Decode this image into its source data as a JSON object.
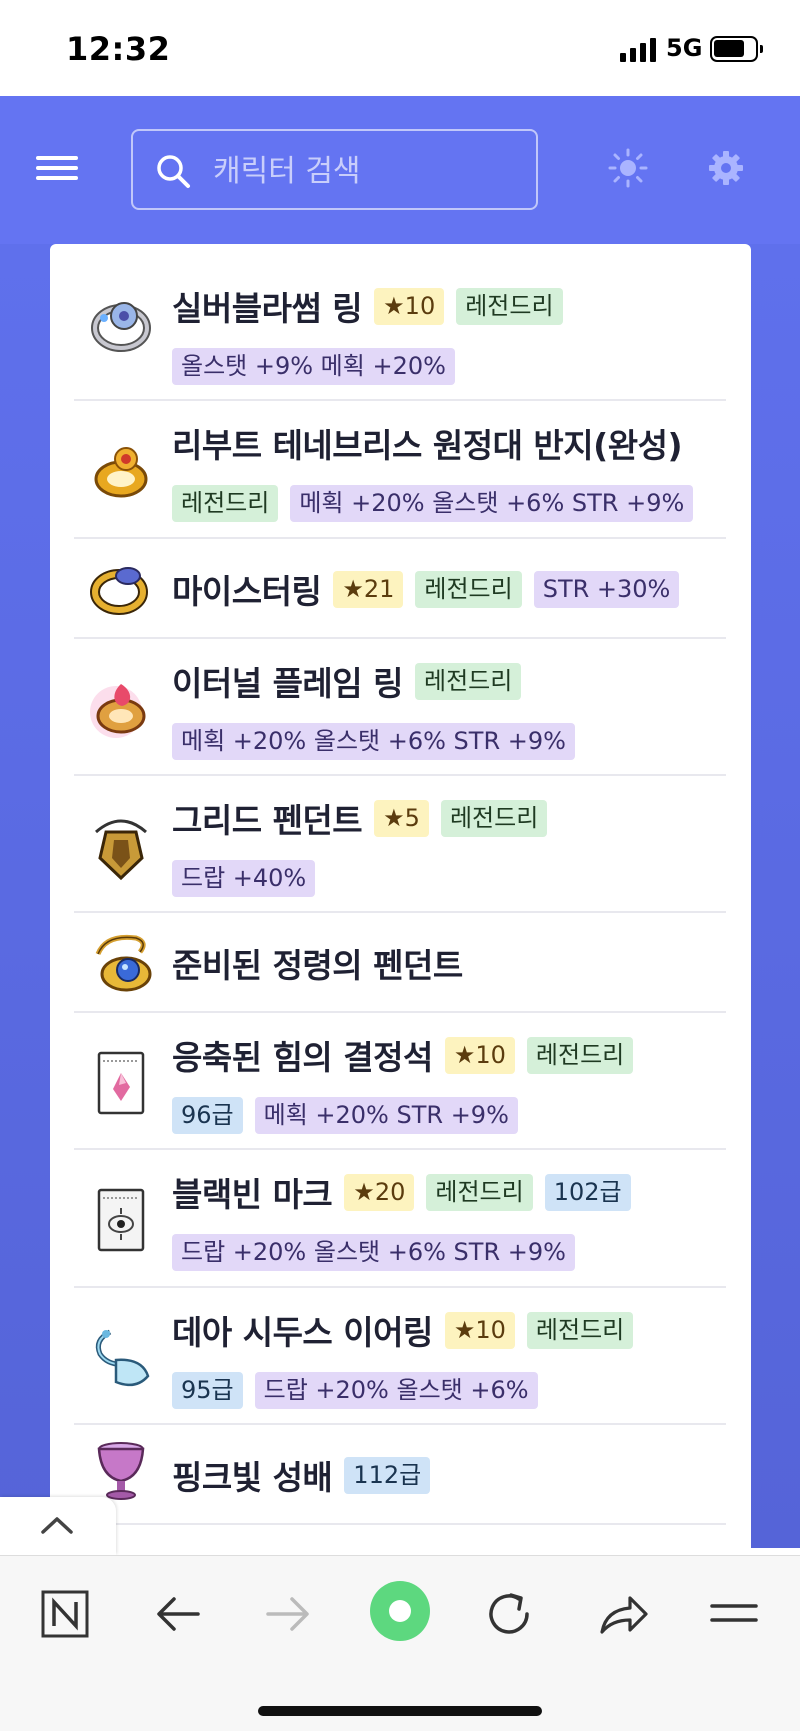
{
  "status_bar": {
    "time": "12:32",
    "network": "5G"
  },
  "search": {
    "placeholder": "캐릭터 검색",
    "value": ""
  },
  "icons": {
    "menu": "hamburger-icon",
    "search": "search-icon",
    "theme": "sun-icon",
    "settings": "gear-icon"
  },
  "colors": {
    "header_bg": "#6474f2",
    "star_tag": "#fdf3bf",
    "grade_tag": "#d5f0d9",
    "stat_tag": "#e2d8f8",
    "tier_tag": "#cfe3f7",
    "reload_button": "#5dd87f"
  },
  "items": [
    {
      "name": "실버블라썸 링",
      "icon": "silver-blossom-ring-icon",
      "line1": [
        {
          "type": "star",
          "text": "★10"
        },
        {
          "type": "grade",
          "text": "레전드리"
        }
      ],
      "line2": [
        {
          "type": "stat",
          "text": "올스탯 +9% 메획 +20%"
        }
      ]
    },
    {
      "name": "리부트 테네브리스 원정대 반지(완성)",
      "icon": "tenebris-ring-icon",
      "line1": [],
      "line2": [
        {
          "type": "grade",
          "text": "레전드리"
        },
        {
          "type": "stat",
          "text": "메획 +20% 올스탯 +6% STR +9%"
        }
      ]
    },
    {
      "name": "마이스터링",
      "icon": "meister-ring-icon",
      "line1": [
        {
          "type": "star",
          "text": "★21"
        },
        {
          "type": "grade",
          "text": "레전드리"
        },
        {
          "type": "stat",
          "text": "STR +30%"
        }
      ],
      "line2": []
    },
    {
      "name": "이터널 플레임 링",
      "icon": "eternal-flame-ring-icon",
      "line1": [
        {
          "type": "grade",
          "text": "레전드리"
        }
      ],
      "line2": [
        {
          "type": "stat",
          "text": "메획 +20% 올스탯 +6% STR +9%"
        }
      ]
    },
    {
      "name": "그리드 펜던트",
      "icon": "greed-pendant-icon",
      "line1": [
        {
          "type": "star",
          "text": "★5"
        },
        {
          "type": "grade",
          "text": "레전드리"
        }
      ],
      "line2": [
        {
          "type": "stat",
          "text": "드랍 +40%"
        }
      ]
    },
    {
      "name": "준비된 정령의 펜던트",
      "icon": "spirit-pendant-icon",
      "line1": [],
      "line2": []
    },
    {
      "name": "응축된 힘의 결정석",
      "icon": "crystal-badge-icon",
      "line1": [
        {
          "type": "star",
          "text": "★10"
        },
        {
          "type": "grade",
          "text": "레전드리"
        }
      ],
      "line2": [
        {
          "type": "tier",
          "text": "96급"
        },
        {
          "type": "stat",
          "text": "메획 +20% STR +9%"
        }
      ]
    },
    {
      "name": "블랙빈 마크",
      "icon": "black-bean-mark-icon",
      "line1": [
        {
          "type": "star",
          "text": "★20"
        },
        {
          "type": "grade",
          "text": "레전드리"
        },
        {
          "type": "tier",
          "text": "102급"
        }
      ],
      "line2": [
        {
          "type": "stat",
          "text": "드랍 +20% 올스탯 +6% STR +9%"
        }
      ]
    },
    {
      "name": "데아 시두스 이어링",
      "icon": "dea-sidus-earring-icon",
      "line1": [
        {
          "type": "star",
          "text": "★10"
        },
        {
          "type": "grade",
          "text": "레전드리"
        }
      ],
      "line2": [
        {
          "type": "tier",
          "text": "95급"
        },
        {
          "type": "stat",
          "text": "드랍 +20% 올스탯 +6%"
        }
      ]
    },
    {
      "name": "핑크빛 성배",
      "icon": "pink-holy-cup-icon",
      "line1": [
        {
          "type": "tier",
          "text": "112급"
        }
      ],
      "line2": []
    }
  ],
  "toolbar": {
    "buttons": [
      "naver-home-icon",
      "back-arrow-icon",
      "forward-arrow-icon",
      "green-dot-button-icon",
      "reload-icon",
      "share-icon",
      "menu-lines-icon"
    ]
  }
}
